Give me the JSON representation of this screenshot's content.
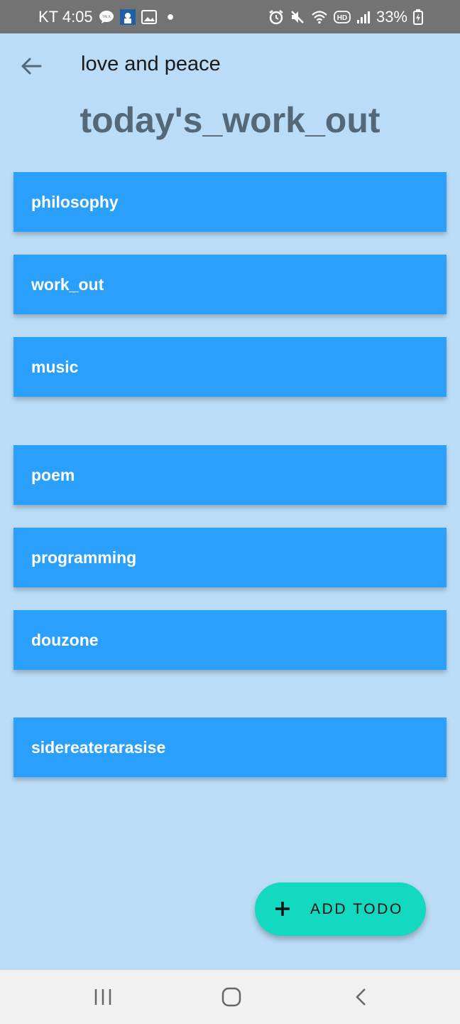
{
  "status_bar": {
    "carrier_time": "KT 4:05",
    "battery": "33%",
    "icons": [
      "talk-icon",
      "app-badge-icon",
      "gallery-icon",
      "dot-icon",
      "alarm-icon",
      "mute-icon",
      "wifi-icon",
      "hd-icon",
      "signal-icon",
      "battery-icon"
    ]
  },
  "app_bar": {
    "back_icon": "arrow-left-icon",
    "title": "love and peace"
  },
  "heading": "today's_work_out",
  "todos": [
    {
      "label": "philosophy"
    },
    {
      "label": "work_out"
    },
    {
      "label": "music"
    },
    {
      "label": "poem"
    },
    {
      "label": "programming"
    },
    {
      "label": "douzone"
    },
    {
      "label": "sidereaterarasise"
    }
  ],
  "fab": {
    "icon": "plus-icon",
    "label": "ADD TODO"
  },
  "nav_bar": {
    "icons": [
      "recents-icon",
      "home-icon",
      "back-icon"
    ]
  },
  "colors": {
    "background": "#badcf6",
    "item": "#2a9ffc",
    "fab": "#12d9c0",
    "heading": "#536878"
  }
}
